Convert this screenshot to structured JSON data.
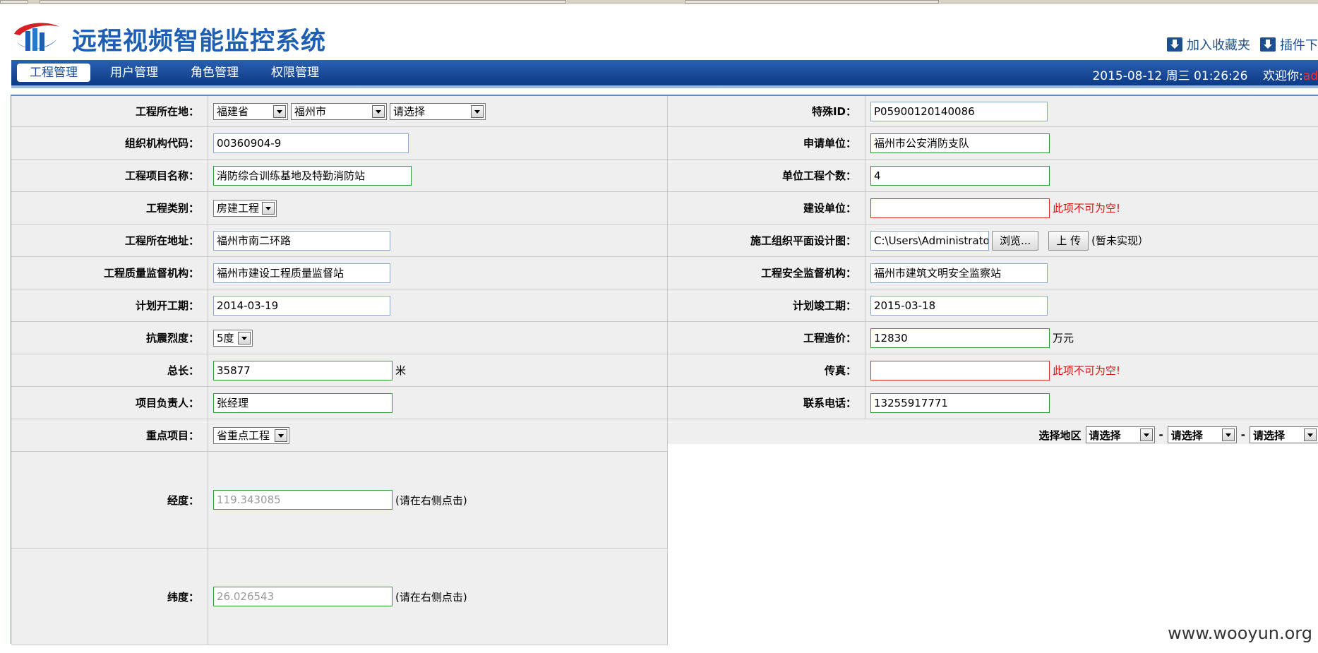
{
  "header": {
    "title": "远程视频智能监控系统",
    "links": [
      "加入收藏夹",
      "插件下"
    ]
  },
  "nav": {
    "tabs": [
      "工程管理",
      "用户管理",
      "角色管理",
      "权限管理"
    ],
    "active_tab": "工程管理",
    "datetime": "2015-08-12 周三 01:26:26",
    "welcome": "欢迎你:",
    "user": "ad"
  },
  "form": {
    "location_label": "工程所在地：",
    "province": "福建省",
    "city": "福州市",
    "district": "请选择",
    "special_id_label": "特殊ID：",
    "special_id": "P05900120140086",
    "org_code_label": "组织机构代码：",
    "org_code": "00360904-9",
    "applicant_label": "申请单位：",
    "applicant": "福州市公安消防支队",
    "project_name_label": "工程项目名称：",
    "project_name": "消防综合训练基地及特勤消防站",
    "unit_count_label": "单位工程个数：",
    "unit_count": "4",
    "category_label": "工程类别：",
    "category": "房建工程",
    "builder_label": "建设单位：",
    "builder": "",
    "required_error": "此项不可为空!",
    "address_label": "工程所在地址：",
    "address": "福州市南二环路",
    "plan_label": "施工组织平面设计图：",
    "plan_file": "C:\\Users\\Administrato",
    "browse_button": "浏览...",
    "upload_button": "上 传",
    "not_implemented": "(暂未实现）",
    "quality_label": "工程质量监督机构：",
    "quality": "福州市建设工程质量监督站",
    "safety_label": "工程安全监督机构：",
    "safety": "福州市建筑文明安全监察站",
    "start_label": "计划开工期：",
    "start_date": "2014-03-19",
    "end_label": "计划竣工期：",
    "end_date": "2015-03-18",
    "seismic_label": "抗震烈度：",
    "seismic": "5度",
    "cost_label": "工程造价：",
    "cost": "12830",
    "cost_unit": "万元",
    "length_label": "总长：",
    "length": "35877",
    "length_unit": "米",
    "fax_label": "传真：",
    "fax": "",
    "manager_label": "项目负责人：",
    "manager": "张经理",
    "phone_label": "联系电话：",
    "phone": "13255917771",
    "key_label": "重点项目：",
    "key_project": "省重点工程",
    "region_label": "选择地区",
    "region_options": [
      "请选择",
      "请选择",
      "请选择"
    ],
    "region_sep": "-",
    "lng_label": "经度：",
    "lng": "119.343085",
    "lat_label": "纬度：",
    "lat": "26.026543",
    "click_hint": "(请在右侧点击)"
  },
  "watermark": "www.wooyun.org"
}
